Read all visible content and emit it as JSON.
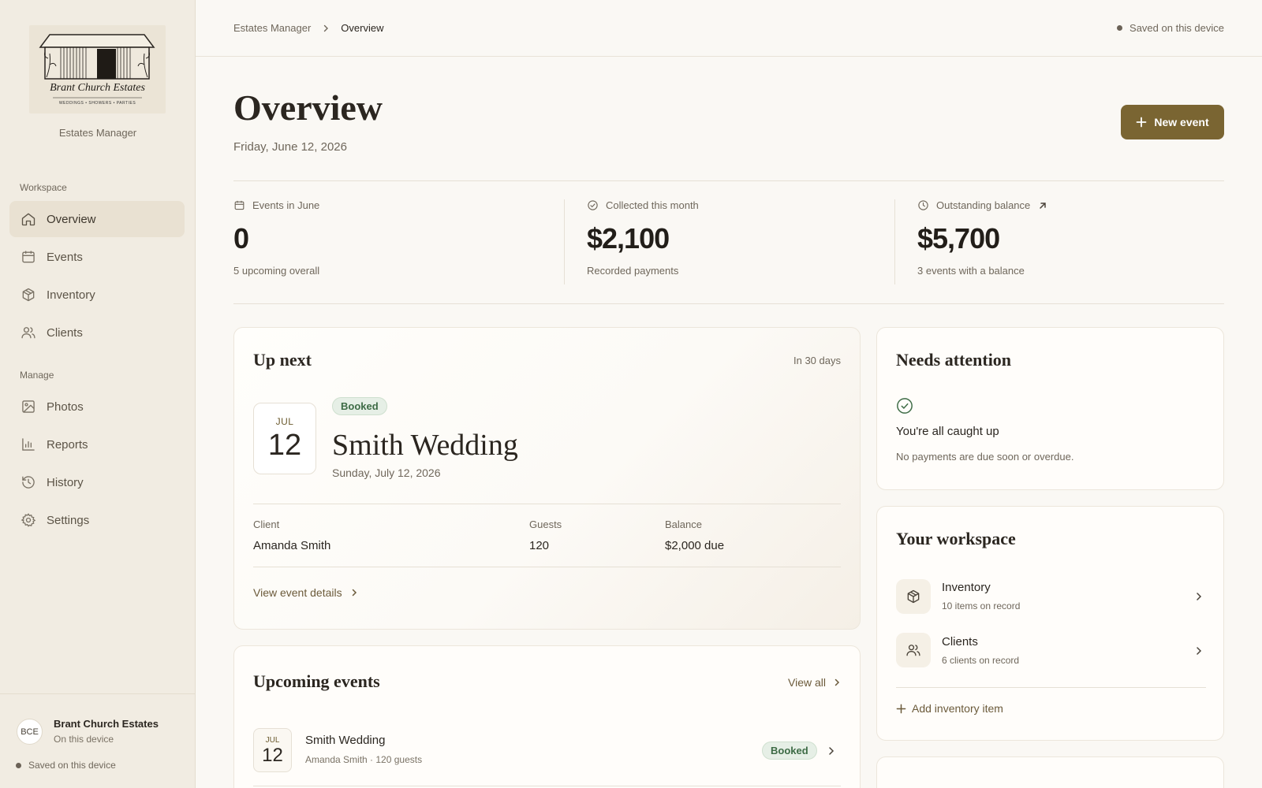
{
  "colors": {
    "accent": "#7a6532",
    "sidebar_bg": "#f1ece2",
    "page_bg": "#faf8f4",
    "booked_bg": "#e6efe6",
    "booked_text": "#3d6b45"
  },
  "sidebar": {
    "logo": {
      "name": "Brant Church Estates",
      "tagline": "WEDDINGS • SHOWERS • PARTIES"
    },
    "app_subtitle": "Estates Manager",
    "sections": [
      {
        "label": "Workspace",
        "items": [
          {
            "label": "Overview",
            "icon": "home-icon",
            "active": true
          },
          {
            "label": "Events",
            "icon": "calendar-icon"
          },
          {
            "label": "Inventory",
            "icon": "box-icon"
          },
          {
            "label": "Clients",
            "icon": "users-icon"
          }
        ]
      },
      {
        "label": "Manage",
        "items": [
          {
            "label": "Photos",
            "icon": "image-icon"
          },
          {
            "label": "Reports",
            "icon": "bar-chart-icon"
          },
          {
            "label": "History",
            "icon": "history-icon"
          },
          {
            "label": "Settings",
            "icon": "gear-icon"
          }
        ]
      }
    ],
    "profile": {
      "initials": "BCE",
      "name": "Brant Church Estates",
      "subtitle": "On this device",
      "status": "Saved on this device"
    }
  },
  "topbar": {
    "breadcrumb": [
      "Estates Manager",
      "Overview"
    ],
    "status": "Saved on this device"
  },
  "header": {
    "title": "Overview",
    "date": "Friday, June 12, 2026",
    "new_button": "New event"
  },
  "stats": [
    {
      "label": "Events in June",
      "value": "0",
      "sub": "5 upcoming overall",
      "icon": "calendar-icon"
    },
    {
      "label": "Collected this month",
      "value": "$2,100",
      "sub": "Recorded payments",
      "icon": "check-circle-icon"
    },
    {
      "label": "Outstanding balance",
      "value": "$5,700",
      "sub": "3 events with a balance",
      "icon": "clock-icon"
    }
  ],
  "up_next": {
    "title": "Up next",
    "in_days": "In 30 days",
    "month": "JUL",
    "day": "12",
    "status": "Booked",
    "event_name": "Smith Wedding",
    "event_date": "Sunday, July 12, 2026",
    "fields": [
      {
        "label": "Client",
        "value": "Amanda Smith"
      },
      {
        "label": "Guests",
        "value": "120"
      },
      {
        "label": "Balance",
        "value": "$2,000 due"
      }
    ],
    "link": "View event details"
  },
  "upcoming": {
    "title": "Upcoming events",
    "view_all": "View all",
    "rows": [
      {
        "month": "JUL",
        "day": "12",
        "name": "Smith Wedding",
        "sub": "Amanda Smith · 120 guests",
        "status": "Booked"
      }
    ]
  },
  "attention": {
    "title": "Needs attention",
    "headline": "You're all caught up",
    "message": "No payments are due soon or overdue."
  },
  "workspace": {
    "title": "Your workspace",
    "items": [
      {
        "title": "Inventory",
        "sub": "10 items on record",
        "icon": "box-icon"
      },
      {
        "title": "Clients",
        "sub": "6 clients on record",
        "icon": "users-icon"
      }
    ],
    "add_link": "Add inventory item"
  }
}
